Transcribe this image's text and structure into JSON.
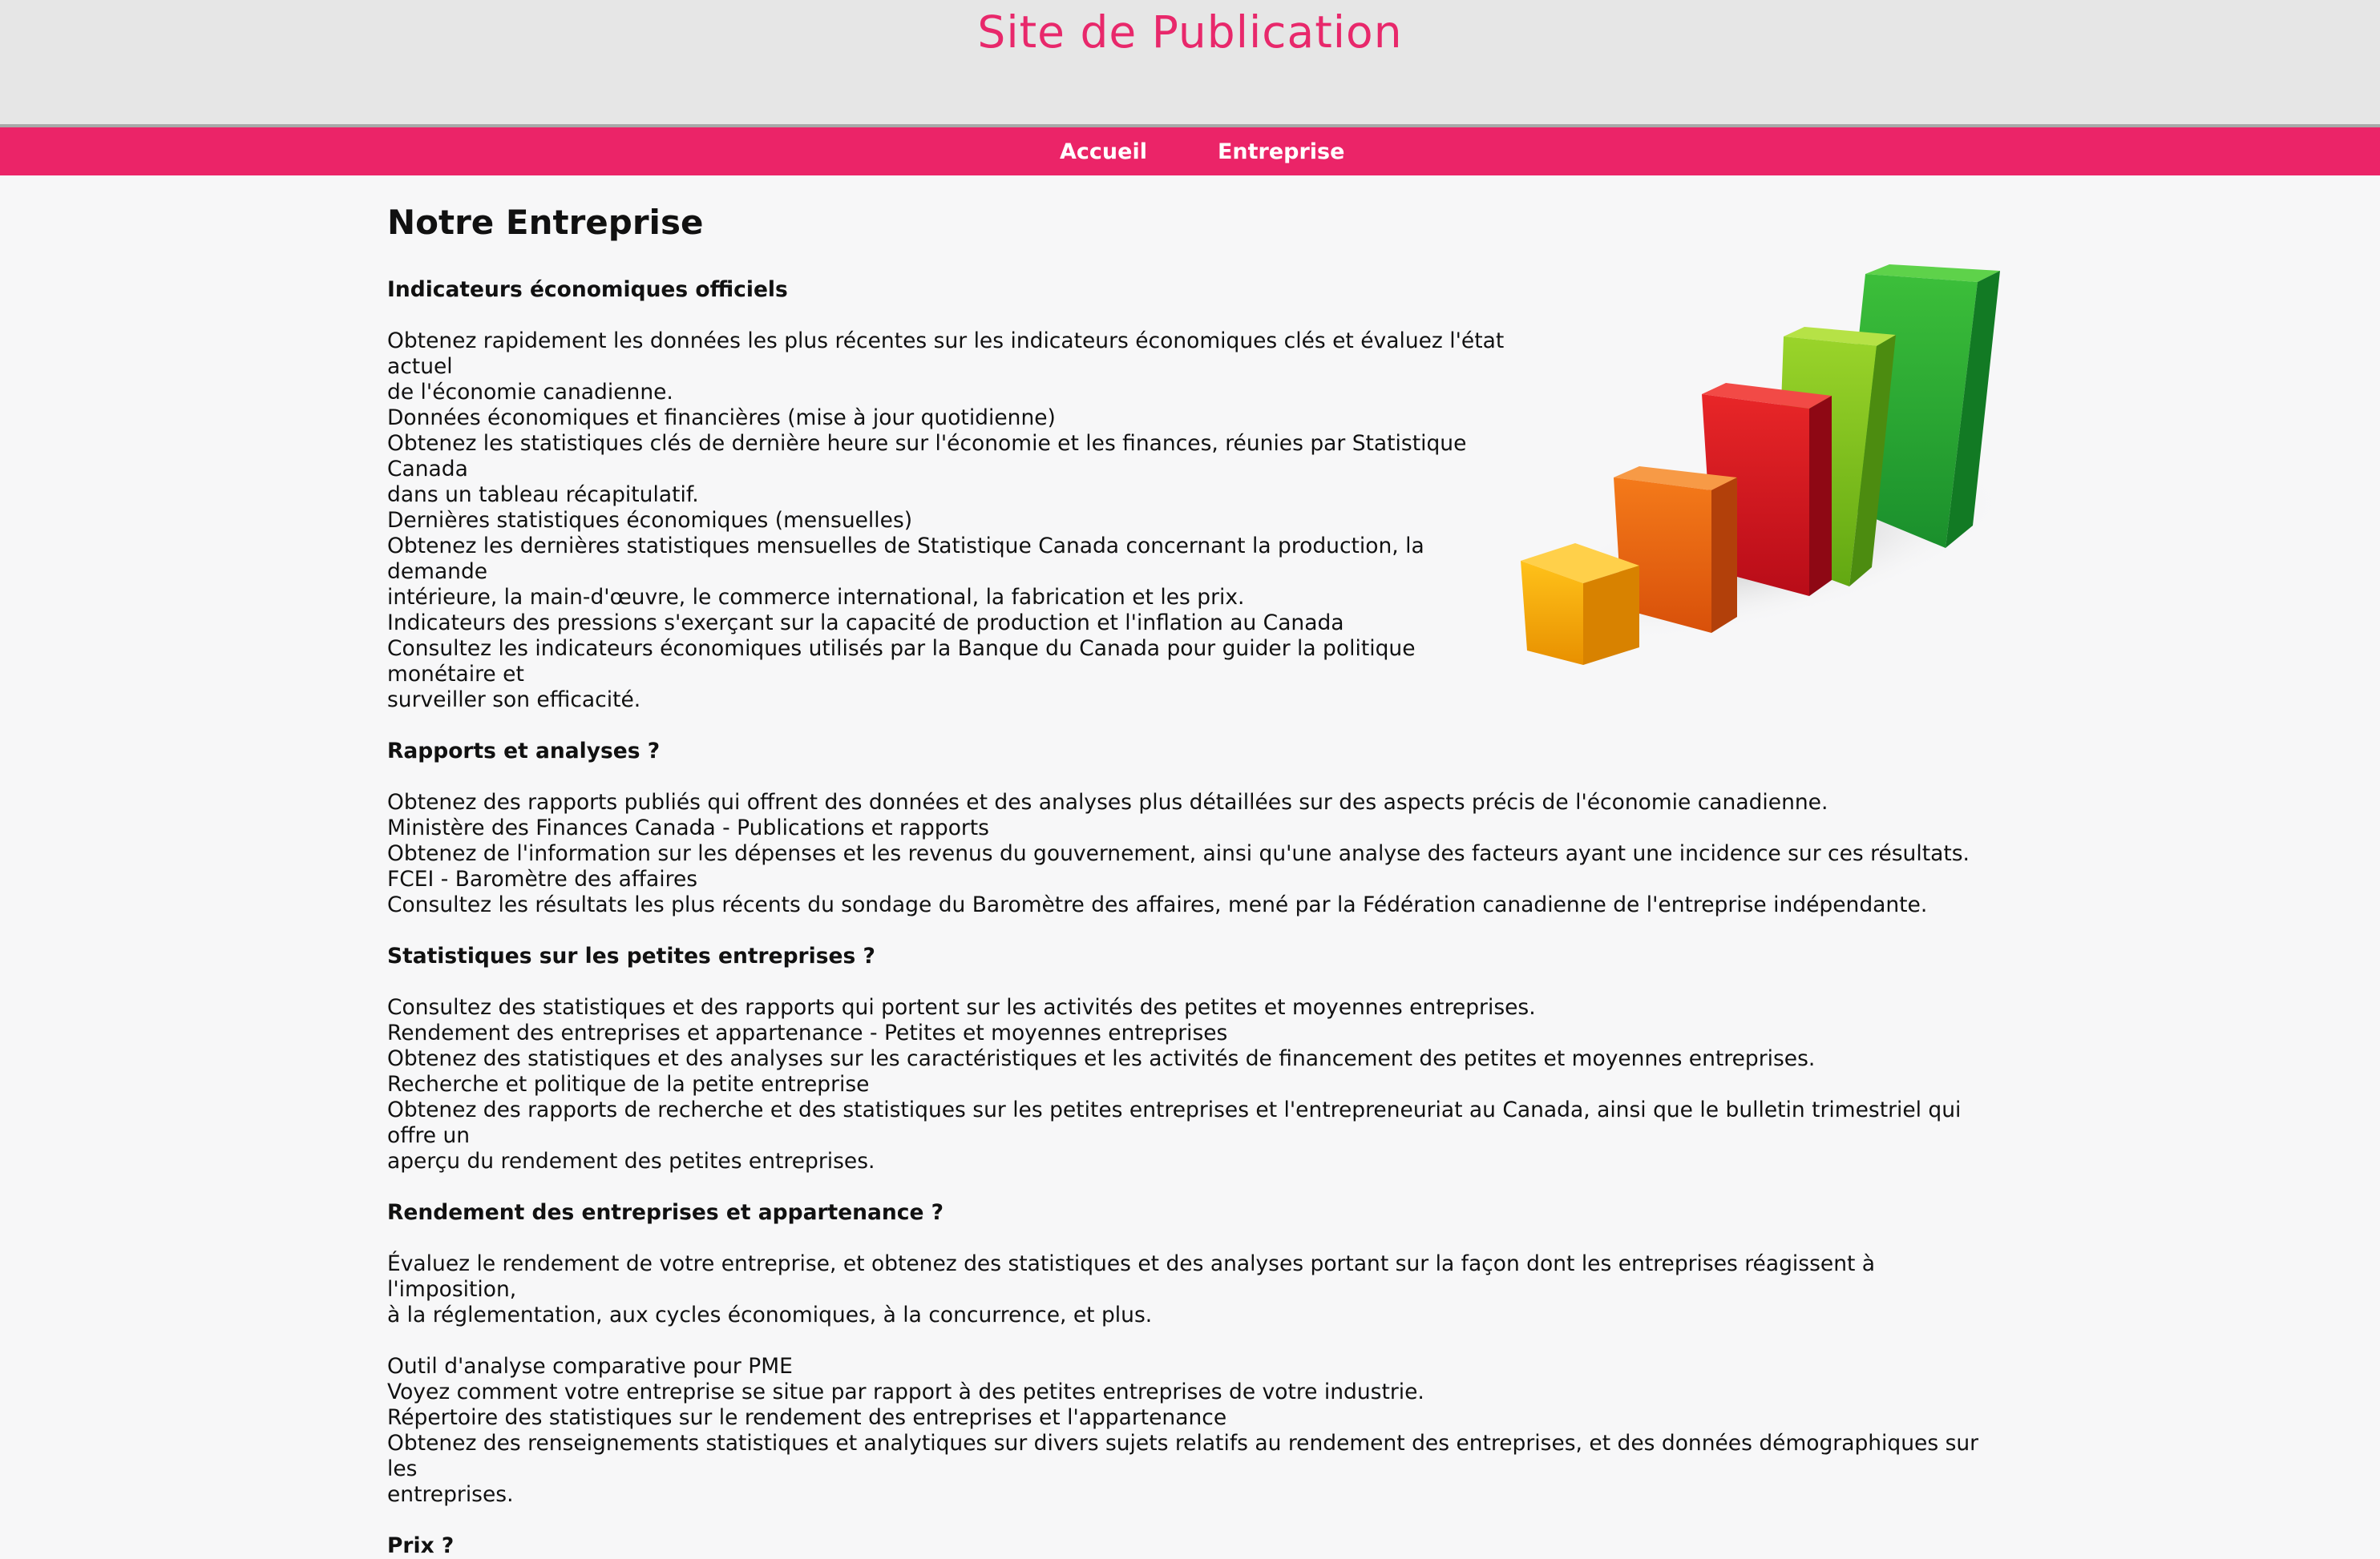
{
  "header": {
    "site_title": "Site de Publication"
  },
  "nav": {
    "items": [
      {
        "label": "Accueil"
      },
      {
        "label": "Entreprise"
      }
    ]
  },
  "main": {
    "page_title": "Notre Entreprise",
    "sections": [
      {
        "heading": "Indicateurs économiques officiels",
        "lines": [
          "Obtenez rapidement les données les plus récentes sur les indicateurs économiques clés et évaluez l'état actuel",
          "de l'économie canadienne.",
          "Données économiques et financières (mise à jour quotidienne)",
          "Obtenez les statistiques clés de dernière heure sur l'économie et les finances, réunies par Statistique Canada",
          "dans un tableau récapitulatif.",
          "Dernières statistiques économiques (mensuelles)",
          "Obtenez les dernières statistiques mensuelles de Statistique Canada concernant la production, la demande",
          "intérieure, la main-d'œuvre, le commerce international, la fabrication et les prix.",
          "Indicateurs des pressions s'exerçant sur la capacité de production et l'inflation au Canada",
          "Consultez les indicateurs économiques utilisés par la Banque du Canada pour guider la politique monétaire et",
          "surveiller son efficacité."
        ]
      },
      {
        "heading": "Rapports et analyses ?",
        "lines": [
          "Obtenez des rapports publiés qui offrent des données et des analyses plus détaillées sur des aspects précis de l'économie canadienne.",
          "Ministère des Finances Canada - Publications et rapports",
          "Obtenez de l'information sur les dépenses et les revenus du gouvernement, ainsi qu'une analyse des facteurs ayant une incidence sur ces résultats.",
          "FCEI - Baromètre des affaires",
          "Consultez les résultats les plus récents du sondage du Baromètre des affaires, mené par la Fédération canadienne de l'entreprise indépendante."
        ]
      },
      {
        "heading": "Statistiques sur les petites entreprises ?",
        "lines": [
          "Consultez des statistiques et des rapports qui portent sur les activités des petites et moyennes entreprises.",
          "Rendement des entreprises et appartenance - Petites et moyennes entreprises",
          "Obtenez des statistiques et des analyses sur les caractéristiques et les activités de financement des petites et moyennes entreprises.",
          "Recherche et politique de la petite entreprise",
          "Obtenez des rapports de recherche et des statistiques sur les petites entreprises et l'entrepreneuriat au Canada, ainsi que le bulletin trimestriel qui offre un",
          "aperçu du rendement des petites entreprises."
        ]
      },
      {
        "heading": "Rendement des entreprises et appartenance ?",
        "lines": [
          "Évaluez le rendement de votre entreprise, et obtenez des statistiques et des analyses portant sur la façon dont les entreprises réagissent à l'imposition,",
          "à la réglementation, aux cycles économiques, à la concurrence, et plus."
        ],
        "lines2": [
          "Outil d'analyse comparative pour PME",
          "Voyez comment votre entreprise se situe par rapport à des petites entreprises de votre industrie.",
          "Répertoire des statistiques sur le rendement des entreprises et l'appartenance",
          "Obtenez des renseignements statistiques et analytiques sur divers sujets relatifs au rendement des entreprises, et des données démographiques sur les",
          "entreprises."
        ]
      },
      {
        "heading": "Prix ?",
        "lines": []
      }
    ]
  },
  "illustration": {
    "name": "3d-bar-chart-illustration",
    "colors": [
      "#f5a800",
      "#e8620c",
      "#cc1020",
      "#7cc21c",
      "#28a83a"
    ]
  }
}
